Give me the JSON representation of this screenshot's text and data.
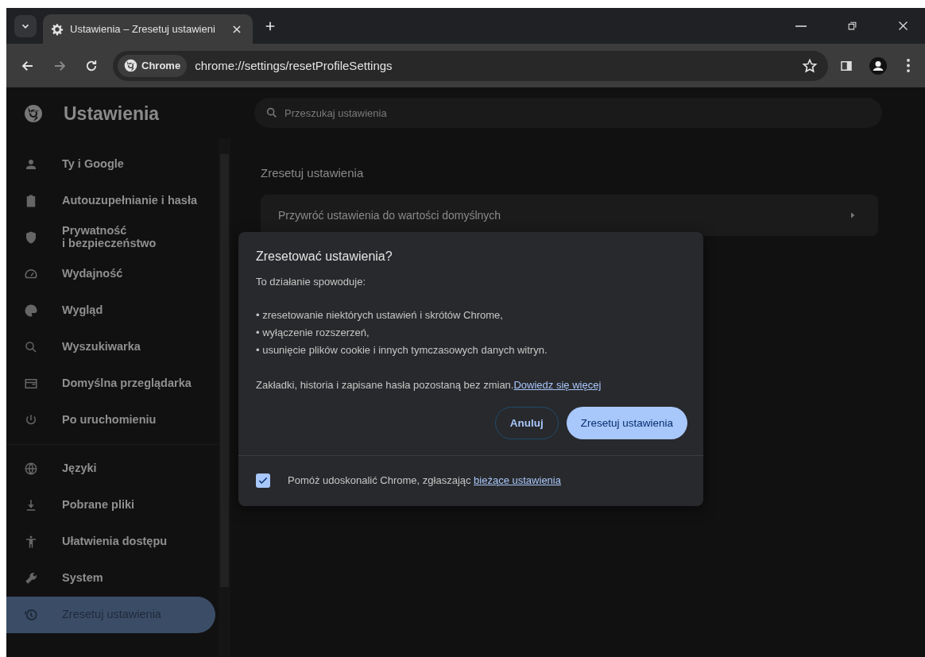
{
  "tab_strip": {
    "tabs": [
      {
        "title": "Ustawienia – Zresetuj ustawieni",
        "selected": true
      }
    ]
  },
  "toolbar": {
    "chip": "Chrome",
    "url": "chrome://settings/resetProfileSettings"
  },
  "sidebar": {
    "title": "Ustawienia",
    "groups": [
      [
        {
          "label": "Ty i Google",
          "selected": false
        },
        {
          "label": "Autouzupełnianie i hasła",
          "selected": false
        },
        {
          "label": "Prywatność\ni bezpieczeństwo",
          "selected": false
        },
        {
          "label": "Wydajność",
          "selected": false
        },
        {
          "label": "Wygląd",
          "selected": false
        },
        {
          "label": "Wyszukiwarka",
          "selected": false
        },
        {
          "label": "Domyślna przeglądarka",
          "selected": false
        },
        {
          "label": "Po uruchomieniu",
          "selected": false
        }
      ],
      [
        {
          "label": "Języki",
          "selected": false
        },
        {
          "label": "Pobrane pliki",
          "selected": false
        },
        {
          "label": "Ułatwienia dostępu",
          "selected": false
        },
        {
          "label": "System",
          "selected": false
        },
        {
          "label": "Zresetuj ustawienia",
          "selected": true
        }
      ]
    ]
  },
  "search": {
    "placeholder": "Przeszukaj ustawienia"
  },
  "section": {
    "heading": "Zresetuj ustawienia",
    "row": "Przywróć ustawienia do wartości domyślnych"
  },
  "dialog": {
    "title": "Zresetować ustawienia?",
    "intro": "To działanie spowoduje:",
    "bullets": [
      "• zresetowanie niektórych ustawień i skrótów Chrome,",
      "• wyłączenie rozszerzeń,",
      "• usunięcie plików cookie i innych tymczasowych danych witryn."
    ],
    "note": "Zakładki, historia i zapisane hasła pozostaną bez zmian.",
    "note_link": "Dowiedz się więcej",
    "buttons": [
      {
        "label": "Anuluj",
        "kind": "secondary"
      },
      {
        "label": "Zresetuj ustawienia",
        "kind": "primary"
      }
    ],
    "report": {
      "checked": true,
      "label": "Pomóż udoskonalić Chrome, zgłaszając ",
      "link": "bieżące ustawienia"
    }
  }
}
